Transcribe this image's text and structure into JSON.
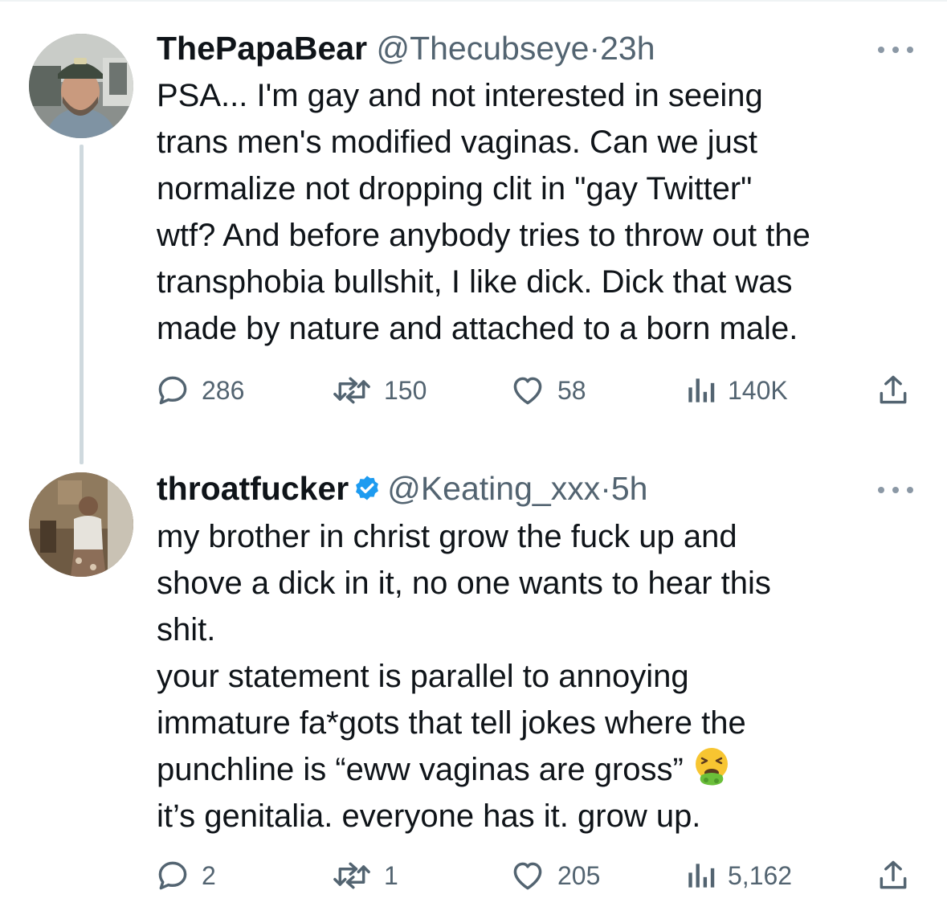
{
  "tweets": [
    {
      "display_name": "ThePapaBear",
      "handle": "@Thecubseye",
      "separator": "·",
      "time": "23h",
      "verified": false,
      "text_lines": [
        "PSA... I'm gay and not interested in seeing",
        "trans men's modified vaginas. Can we just",
        "normalize not dropping clit  in \"gay Twitter\"",
        "wtf? And before anybody tries to throw out the",
        "transphobia bullshit, I like dick. Dick that was",
        "made by nature and attached to a born male."
      ],
      "replies": "286",
      "retweets": "150",
      "likes": "58",
      "views": "140K"
    },
    {
      "display_name": "throatfucker",
      "handle": "@Keating_xxx",
      "separator": "·",
      "time": "5h",
      "verified": true,
      "text_lines": [
        "my brother in christ grow the fuck up and",
        "shove a dick in it, no one wants to hear this",
        "shit.",
        "your statement is parallel to annoying",
        "immature fa*gots that tell jokes where the",
        "punchline is “eww vaginas are gross”",
        "it’s genitalia. everyone has it. grow up."
      ],
      "replies": "2",
      "retweets": "1",
      "likes": "205",
      "views": "5,162"
    }
  ],
  "icons": {
    "reply": "reply-icon",
    "retweet": "retweet-icon",
    "like": "heart-icon",
    "views": "views-chart-icon",
    "share": "share-icon",
    "more": "more-options-icon",
    "verified": "verified-badge-icon",
    "emoji": "nauseated-face-emoji"
  },
  "colors": {
    "text_primary": "#0f1419",
    "text_secondary": "#536471",
    "verified_blue": "#1d9bf0",
    "thread_line": "#cfd9de"
  }
}
